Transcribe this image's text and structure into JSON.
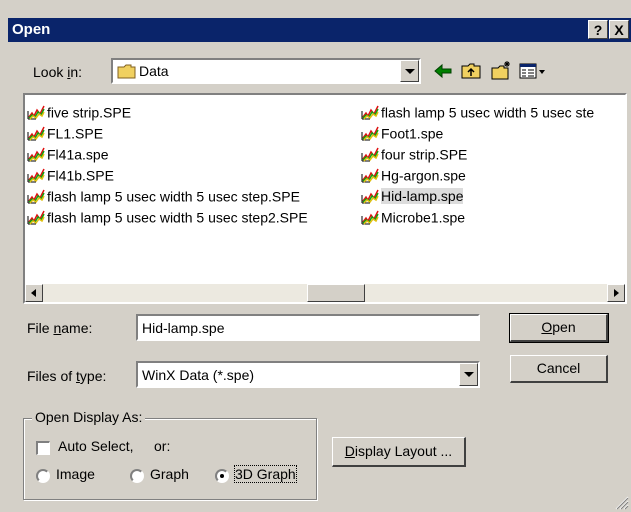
{
  "window": {
    "title": "Open",
    "help_glyph": "?",
    "close_glyph": "X"
  },
  "look_in": {
    "label_pre": "Look ",
    "label_u": "i",
    "label_post": "n:",
    "value": "Data"
  },
  "toolbar": {
    "icons": [
      "back-icon",
      "up-folder-icon",
      "new-folder-icon",
      "view-menu-icon"
    ]
  },
  "files": {
    "col1": [
      "five strip.SPE",
      "FL1.SPE",
      "Fl41a.spe",
      "Fl41b.SPE",
      "flash lamp 5 usec width 5 usec step.SPE",
      "flash lamp 5 usec width 5 usec step2.SPE"
    ],
    "col2": [
      "flash lamp 5 usec width 5 usec ste",
      "Foot1.spe",
      "four strip.SPE",
      "Hg-argon.spe",
      "Hid-lamp.spe",
      "Microbe1.spe"
    ],
    "selected": "Hid-lamp.spe"
  },
  "file_name": {
    "label_pre": "File ",
    "label_u": "n",
    "label_post": "ame:",
    "value": "Hid-lamp.spe"
  },
  "files_of_type": {
    "label_pre": "Files of ",
    "label_u": "t",
    "label_post": "ype:",
    "value": "WinX Data (*.spe)"
  },
  "buttons": {
    "open_u": "O",
    "open_rest": "pen",
    "cancel": "Cancel",
    "display_u": "D",
    "display_rest": "isplay Layout ..."
  },
  "display_group": {
    "title": "Open Display As:",
    "auto_select": "Auto Select,",
    "or": "or:",
    "radios": [
      "Image",
      "Graph",
      "3D Graph"
    ],
    "selected_radio": "3D Graph",
    "auto_select_checked": false
  },
  "colors": {
    "title_bar": "#0a246a",
    "dialog": "#d4d0c8",
    "folder": "#f0d060"
  }
}
